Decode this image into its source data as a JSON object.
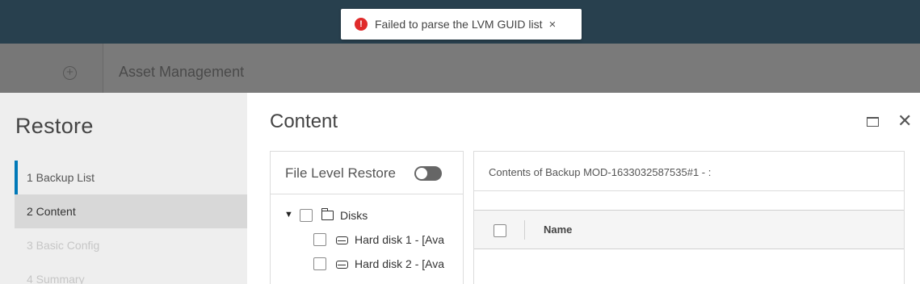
{
  "toast": {
    "message": "Failed to parse the LVM GUID list",
    "close_glyph": "×",
    "error_glyph": "!",
    "status_color": "#e02b2b"
  },
  "background": {
    "add_glyph": "+",
    "title": "Asset Management"
  },
  "wizard": {
    "title": "Restore",
    "steps": [
      {
        "label": "1  Backup List",
        "state": "completed"
      },
      {
        "label": "2  Content",
        "state": "active"
      },
      {
        "label": "3  Basic Config",
        "state": "disabled"
      },
      {
        "label": "4  Summary",
        "state": "disabled"
      }
    ],
    "accent_color": "#0079b8"
  },
  "content": {
    "title": "Content",
    "close_glyph": "✕",
    "file_level_restore": {
      "label": "File Level Restore",
      "enabled": false
    },
    "tree": {
      "root": {
        "label": "Disks",
        "expanded": true,
        "caret_glyph": "▼"
      },
      "children": [
        {
          "label": "Hard disk 1 - [Ava"
        },
        {
          "label": "Hard disk 2 - [Ava"
        }
      ]
    },
    "details": {
      "heading": "Contents of Backup MOD-1633032587535#1 - :",
      "columns": [
        "Name"
      ]
    }
  }
}
